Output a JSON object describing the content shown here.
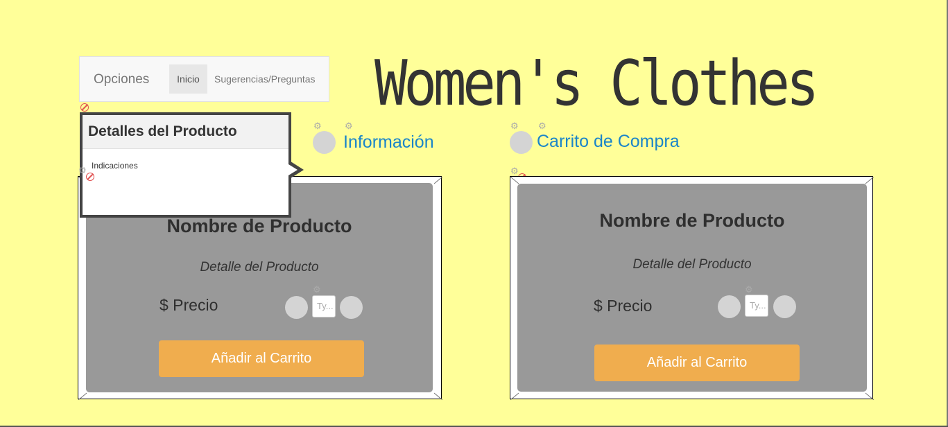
{
  "navbar": {
    "brand": "Opciones",
    "items": [
      {
        "label": "Inicio",
        "active": true
      },
      {
        "label": "Sugerencias/Preguntas",
        "active": false
      }
    ]
  },
  "title": "Women's Clothes",
  "sections": {
    "info_label": "Información",
    "cart_label": "Carrito de Compra"
  },
  "popover": {
    "title": "Detalles del Producto",
    "body": "Indicaciones"
  },
  "products": [
    {
      "name": "Nombre de Producto",
      "detail": "Detalle del Producto",
      "price": "$ Precio",
      "qty_placeholder": "Ty...",
      "add_label": "Añadir al Carrito"
    },
    {
      "name": "Nombre de Producto",
      "detail": "Detalle del Producto",
      "price": "$ Precio",
      "qty_placeholder": "Ty...",
      "add_label": "Añadir al Carrito"
    }
  ],
  "colors": {
    "background": "#ffff99",
    "accent_button": "#f0ad4e",
    "link": "#1a85c9",
    "card": "#999999"
  },
  "icons": [
    "gear-icon",
    "hidden-icon"
  ]
}
